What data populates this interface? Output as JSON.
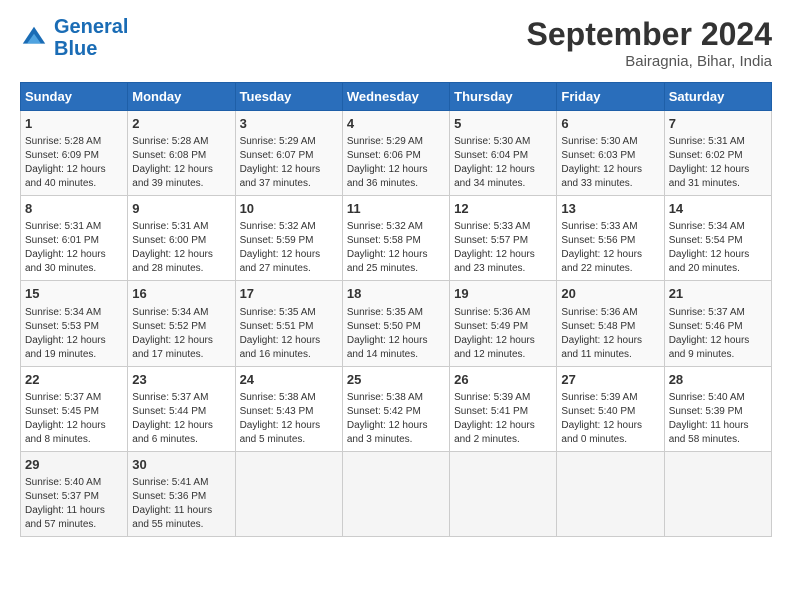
{
  "header": {
    "logo_line1": "General",
    "logo_line2": "Blue",
    "month": "September 2024",
    "location": "Bairagnia, Bihar, India"
  },
  "days_of_week": [
    "Sunday",
    "Monday",
    "Tuesday",
    "Wednesday",
    "Thursday",
    "Friday",
    "Saturday"
  ],
  "weeks": [
    [
      {
        "day": "1",
        "info": "Sunrise: 5:28 AM\nSunset: 6:09 PM\nDaylight: 12 hours\nand 40 minutes."
      },
      {
        "day": "2",
        "info": "Sunrise: 5:28 AM\nSunset: 6:08 PM\nDaylight: 12 hours\nand 39 minutes."
      },
      {
        "day": "3",
        "info": "Sunrise: 5:29 AM\nSunset: 6:07 PM\nDaylight: 12 hours\nand 37 minutes."
      },
      {
        "day": "4",
        "info": "Sunrise: 5:29 AM\nSunset: 6:06 PM\nDaylight: 12 hours\nand 36 minutes."
      },
      {
        "day": "5",
        "info": "Sunrise: 5:30 AM\nSunset: 6:04 PM\nDaylight: 12 hours\nand 34 minutes."
      },
      {
        "day": "6",
        "info": "Sunrise: 5:30 AM\nSunset: 6:03 PM\nDaylight: 12 hours\nand 33 minutes."
      },
      {
        "day": "7",
        "info": "Sunrise: 5:31 AM\nSunset: 6:02 PM\nDaylight: 12 hours\nand 31 minutes."
      }
    ],
    [
      {
        "day": "8",
        "info": "Sunrise: 5:31 AM\nSunset: 6:01 PM\nDaylight: 12 hours\nand 30 minutes."
      },
      {
        "day": "9",
        "info": "Sunrise: 5:31 AM\nSunset: 6:00 PM\nDaylight: 12 hours\nand 28 minutes."
      },
      {
        "day": "10",
        "info": "Sunrise: 5:32 AM\nSunset: 5:59 PM\nDaylight: 12 hours\nand 27 minutes."
      },
      {
        "day": "11",
        "info": "Sunrise: 5:32 AM\nSunset: 5:58 PM\nDaylight: 12 hours\nand 25 minutes."
      },
      {
        "day": "12",
        "info": "Sunrise: 5:33 AM\nSunset: 5:57 PM\nDaylight: 12 hours\nand 23 minutes."
      },
      {
        "day": "13",
        "info": "Sunrise: 5:33 AM\nSunset: 5:56 PM\nDaylight: 12 hours\nand 22 minutes."
      },
      {
        "day": "14",
        "info": "Sunrise: 5:34 AM\nSunset: 5:54 PM\nDaylight: 12 hours\nand 20 minutes."
      }
    ],
    [
      {
        "day": "15",
        "info": "Sunrise: 5:34 AM\nSunset: 5:53 PM\nDaylight: 12 hours\nand 19 minutes."
      },
      {
        "day": "16",
        "info": "Sunrise: 5:34 AM\nSunset: 5:52 PM\nDaylight: 12 hours\nand 17 minutes."
      },
      {
        "day": "17",
        "info": "Sunrise: 5:35 AM\nSunset: 5:51 PM\nDaylight: 12 hours\nand 16 minutes."
      },
      {
        "day": "18",
        "info": "Sunrise: 5:35 AM\nSunset: 5:50 PM\nDaylight: 12 hours\nand 14 minutes."
      },
      {
        "day": "19",
        "info": "Sunrise: 5:36 AM\nSunset: 5:49 PM\nDaylight: 12 hours\nand 12 minutes."
      },
      {
        "day": "20",
        "info": "Sunrise: 5:36 AM\nSunset: 5:48 PM\nDaylight: 12 hours\nand 11 minutes."
      },
      {
        "day": "21",
        "info": "Sunrise: 5:37 AM\nSunset: 5:46 PM\nDaylight: 12 hours\nand 9 minutes."
      }
    ],
    [
      {
        "day": "22",
        "info": "Sunrise: 5:37 AM\nSunset: 5:45 PM\nDaylight: 12 hours\nand 8 minutes."
      },
      {
        "day": "23",
        "info": "Sunrise: 5:37 AM\nSunset: 5:44 PM\nDaylight: 12 hours\nand 6 minutes."
      },
      {
        "day": "24",
        "info": "Sunrise: 5:38 AM\nSunset: 5:43 PM\nDaylight: 12 hours\nand 5 minutes."
      },
      {
        "day": "25",
        "info": "Sunrise: 5:38 AM\nSunset: 5:42 PM\nDaylight: 12 hours\nand 3 minutes."
      },
      {
        "day": "26",
        "info": "Sunrise: 5:39 AM\nSunset: 5:41 PM\nDaylight: 12 hours\nand 2 minutes."
      },
      {
        "day": "27",
        "info": "Sunrise: 5:39 AM\nSunset: 5:40 PM\nDaylight: 12 hours\nand 0 minutes."
      },
      {
        "day": "28",
        "info": "Sunrise: 5:40 AM\nSunset: 5:39 PM\nDaylight: 11 hours\nand 58 minutes."
      }
    ],
    [
      {
        "day": "29",
        "info": "Sunrise: 5:40 AM\nSunset: 5:37 PM\nDaylight: 11 hours\nand 57 minutes."
      },
      {
        "day": "30",
        "info": "Sunrise: 5:41 AM\nSunset: 5:36 PM\nDaylight: 11 hours\nand 55 minutes."
      },
      {
        "day": "",
        "info": ""
      },
      {
        "day": "",
        "info": ""
      },
      {
        "day": "",
        "info": ""
      },
      {
        "day": "",
        "info": ""
      },
      {
        "day": "",
        "info": ""
      }
    ]
  ]
}
